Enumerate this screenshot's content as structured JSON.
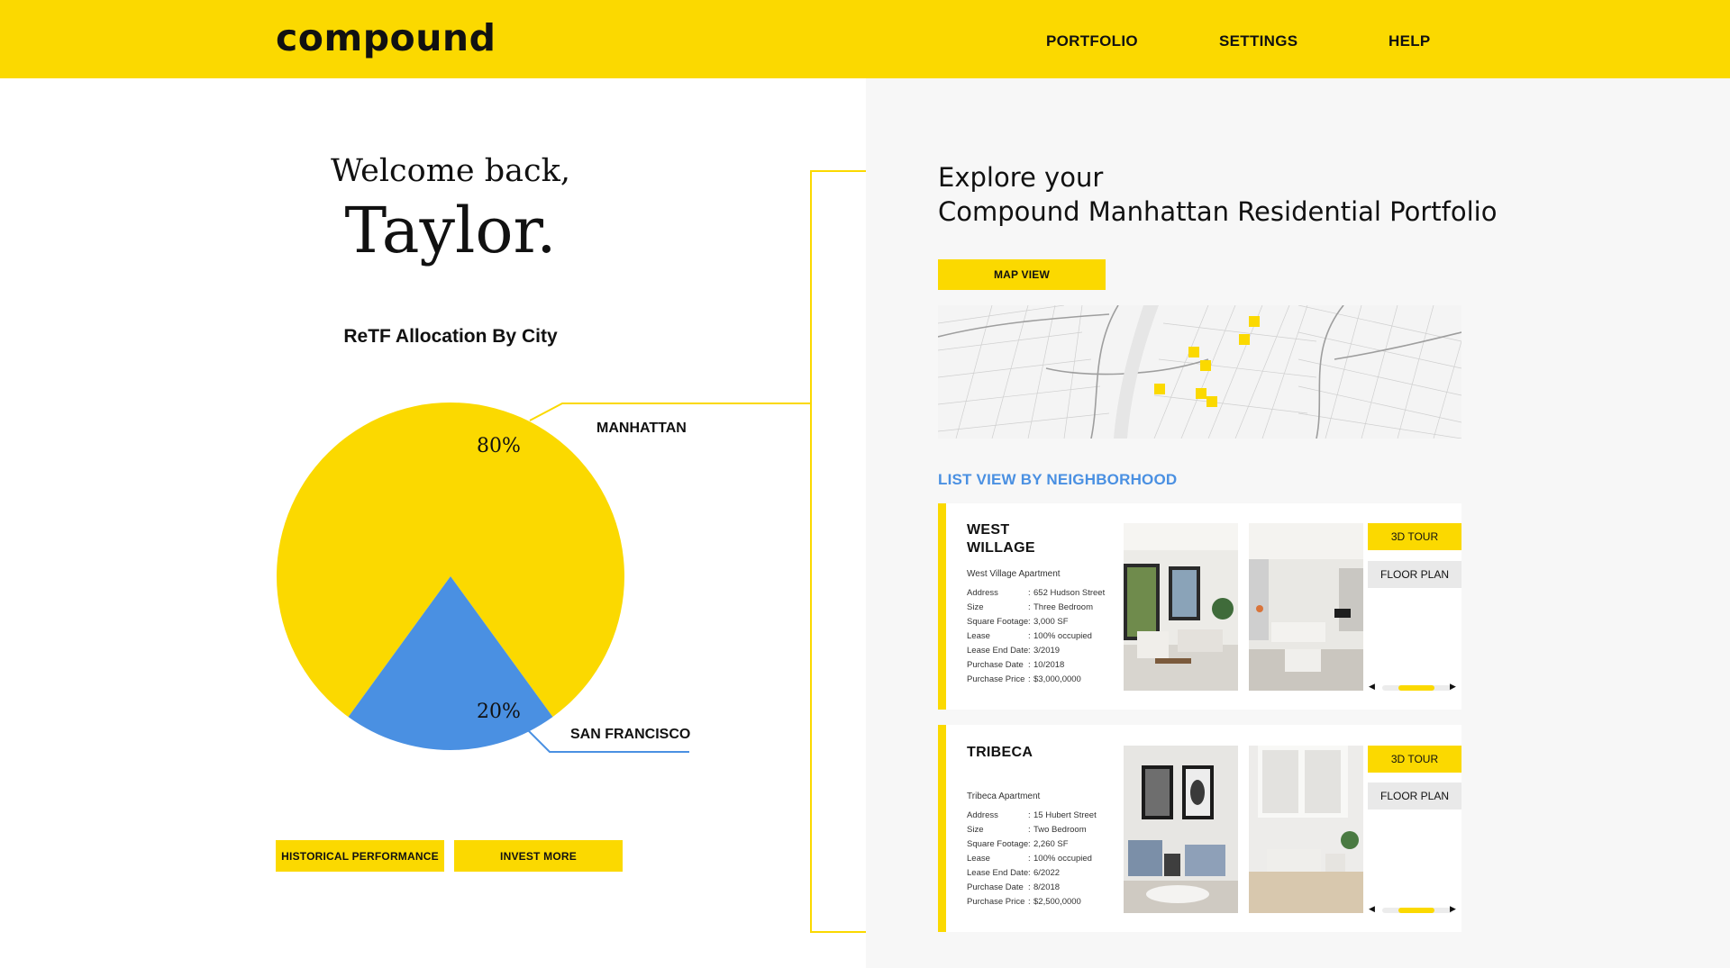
{
  "brand": {
    "logo": "compound",
    "accent": "#fbd900",
    "blue": "#4a90e2"
  },
  "nav": {
    "portfolio": "PORTFOLIO",
    "settings": "SETTINGS",
    "help": "HELP"
  },
  "welcome": {
    "line1": "Welcome back,",
    "name": "Taylor."
  },
  "chart": {
    "title": "ReTF Allocation By City",
    "slices": [
      {
        "label": "MANHATTAN",
        "percent_label": "80%",
        "color": "#fbd900"
      },
      {
        "label": "SAN FRANCISCO",
        "percent_label": "20%",
        "color": "#4a90e2"
      }
    ]
  },
  "chart_data": {
    "type": "pie",
    "title": "ReTF Allocation By City",
    "categories": [
      "MANHATTAN",
      "SAN FRANCISCO"
    ],
    "values": [
      80,
      20
    ],
    "colors": [
      "#fbd900",
      "#4a90e2"
    ]
  },
  "actions": {
    "historical": "HISTORICAL PERFORMANCE",
    "invest": "INVEST MORE"
  },
  "explore": {
    "line1": "Explore your",
    "line2": "Compound Manhattan Residential Portfolio"
  },
  "map": {
    "button": "MAP VIEW"
  },
  "list": {
    "title": "LIST VIEW BY NEIGHBORHOOD",
    "labels": [
      "Address",
      "Size",
      "Square Footage",
      "Lease",
      "Lease End Date",
      "Purchase Date",
      "Purchase Price"
    ],
    "tour_label": "3D TOUR",
    "plan_label": "FLOOR PLAN",
    "prev_icon": "◀",
    "next_icon": "▶",
    "items": [
      {
        "name_line1": "WEST",
        "name_line2": "WILLAGE",
        "apartment": "West Village Apartment",
        "values": [
          "652 Hudson Street",
          "Three Bedroom",
          "3,000 SF",
          "100% occupied",
          "3/2019",
          "10/2018",
          "$3,000,0000"
        ]
      },
      {
        "name_line1": "TRIBECA",
        "name_line2": "",
        "apartment": "Tribeca Apartment",
        "values": [
          "15 Hubert Street",
          "Two Bedroom",
          "2,260 SF",
          "100% occupied",
          "6/2022",
          "8/2018",
          "$2,500,0000"
        ]
      }
    ]
  }
}
